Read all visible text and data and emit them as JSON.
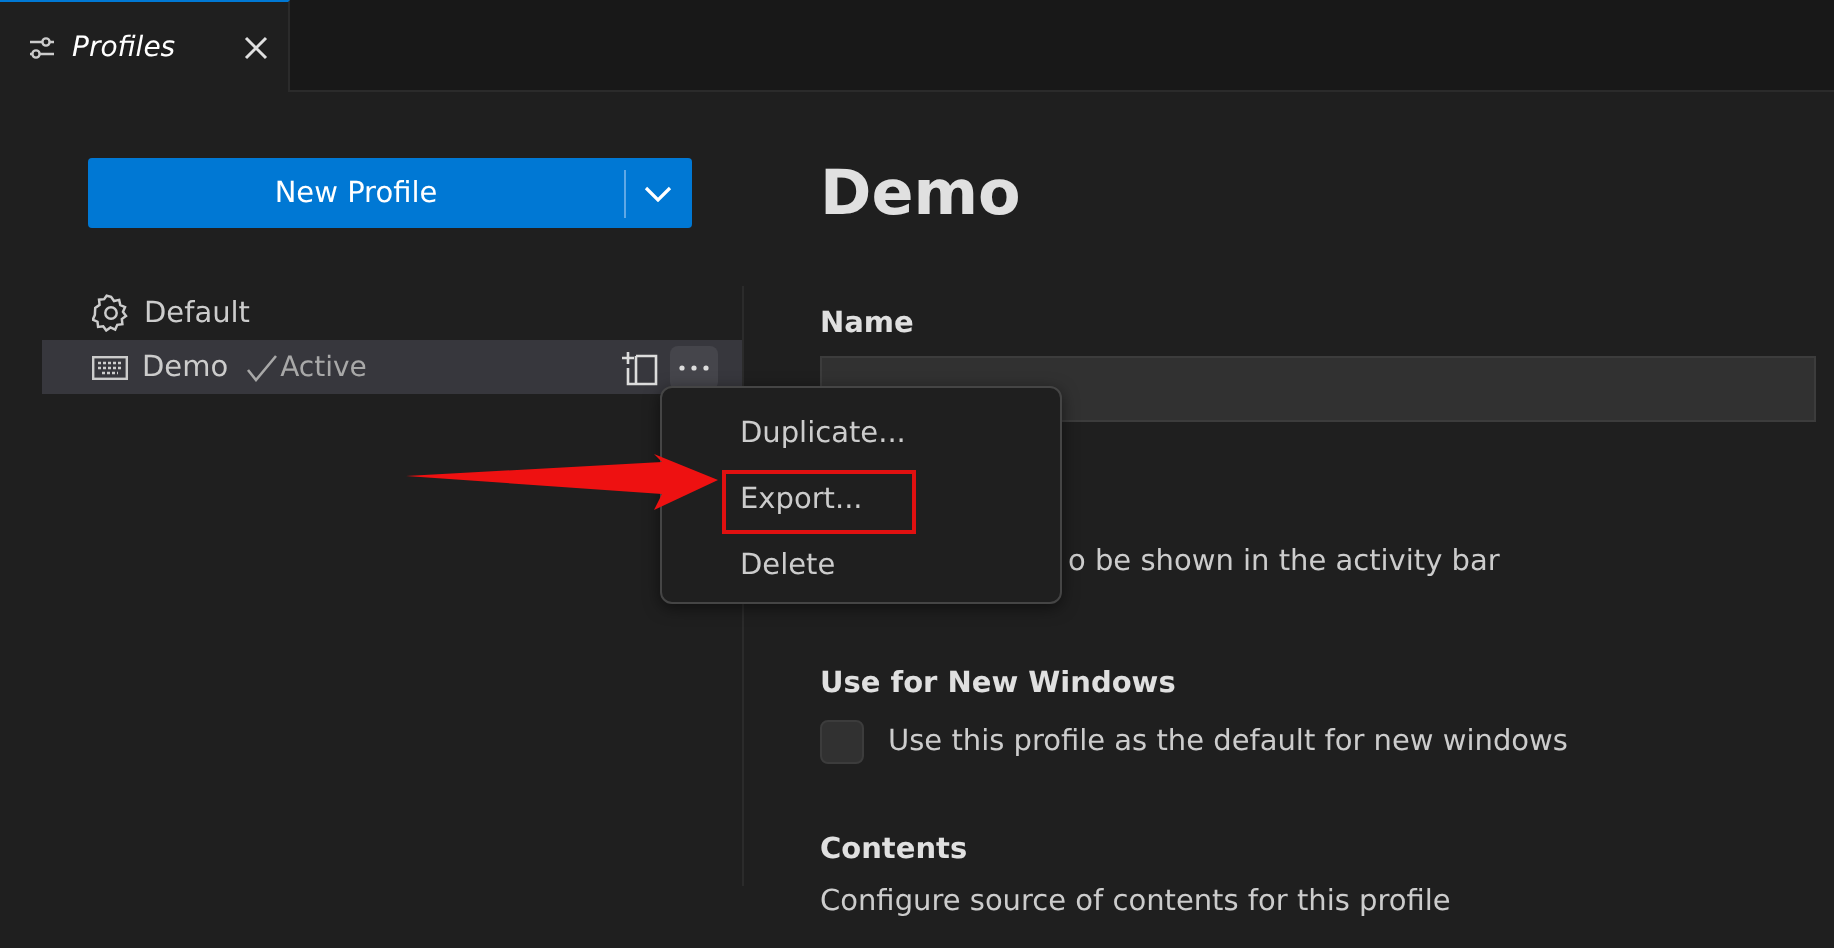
{
  "tab": {
    "title": "Profiles"
  },
  "new_profile_button": {
    "label": "New Profile"
  },
  "profiles": [
    {
      "name": "Default",
      "kind": "default",
      "selected": false
    },
    {
      "name": "Demo",
      "kind": "keyboard",
      "selected": true,
      "badge": "Active"
    }
  ],
  "editor": {
    "title": "Demo",
    "sections": [
      {
        "kind": "name",
        "label": "Name"
      },
      {
        "kind": "icon",
        "description": "o be shown in the activity bar"
      },
      {
        "kind": "checkbox",
        "label": "Use for New Windows",
        "description": "Use this profile as the default for new windows",
        "checked": false
      },
      {
        "kind": "text",
        "label": "Contents",
        "description": "Configure source of contents for this profile"
      }
    ]
  },
  "context_menu": {
    "items": [
      {
        "label": "Duplicate...",
        "annotated": false
      },
      {
        "label": "Export...",
        "annotated": true
      },
      {
        "label": "Delete",
        "annotated": false
      }
    ]
  }
}
